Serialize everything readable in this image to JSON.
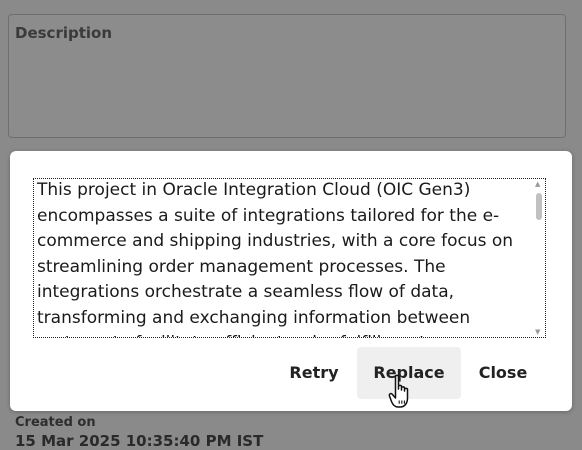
{
  "background_form": {
    "description_label": "Description",
    "created_label": "Created on",
    "created_value": "15 Mar 2025 10:35:40 PM IST"
  },
  "dialog": {
    "text": "This project in Oracle Integration Cloud (OIC Gen3) encompasses a suite of integrations tailored for the e-commerce and shipping industries, with a core focus on streamlining order management processes. The integrations orchestrate a seamless flow of data, transforming and exchanging information between systems to facilitate efficient order fulfillment",
    "buttons": {
      "retry": "Retry",
      "replace": "Replace",
      "close": "Close"
    }
  },
  "icons": {
    "cursor": "hand-pointer-icon",
    "scroll_up": "scroll-up-arrow-icon",
    "scroll_down": "scroll-down-arrow-icon"
  },
  "colors": {
    "overlay": "#8a8a8a",
    "dialog_background": "#ffffff",
    "hover_button": "#efefef"
  }
}
